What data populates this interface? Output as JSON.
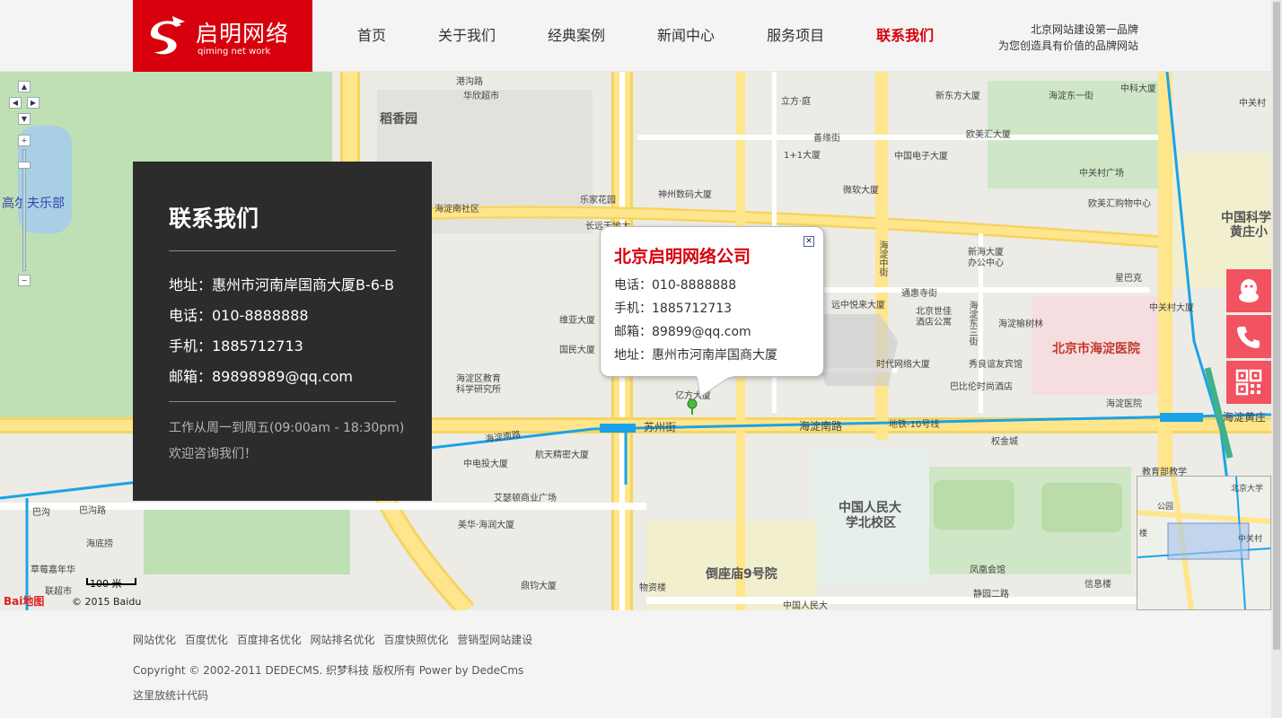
{
  "header": {
    "logo_cn": "启明网络",
    "logo_en": "qiming net work",
    "nav": [
      {
        "label": "首页",
        "active": false
      },
      {
        "label": "关于我们",
        "active": false
      },
      {
        "label": "经典案例",
        "active": false
      },
      {
        "label": "新闻中心",
        "active": false
      },
      {
        "label": "服务项目",
        "active": false
      },
      {
        "label": "联系我们",
        "active": true
      }
    ],
    "slogan_line1": "北京网站建设第一品牌",
    "slogan_line2": "为您创造具有价值的品牌网站"
  },
  "contact": {
    "title": "联系我们",
    "address": "地址：惠州市河南岸国商大厦B-6-B",
    "phone": "电话：010-8888888",
    "mobile": "手机：1885712713",
    "email": "邮箱：89898989@qq.com",
    "hours": "工作从周一到周五(09:00am - 18:30pm)",
    "welcome": "欢迎咨询我们！"
  },
  "popup": {
    "title": "北京启明网络公司",
    "phone": "电话：010-8888888",
    "mobile": "手机：1885712713",
    "email": "邮箱：89899@qq.com",
    "address": "地址：惠州市河南岸国商大厦",
    "close": "✕"
  },
  "map": {
    "scale_label": "100 米",
    "copyright": "© 2015 Baidu",
    "baidu_logo": "Bai地图",
    "labels": {
      "l1": "港沟路",
      "l2": "华欣超市",
      "l3": "稻香园",
      "l4": "立方·庭",
      "l5": "新东方大厦",
      "l6": "海淀东一街",
      "l7": "中科大厦",
      "l8": "中关村",
      "l9": "善缘街",
      "l10": "1+1大厦",
      "l11": "中国电子大厦",
      "l12": "欧美汇大厦",
      "l13": "中关村广场",
      "l14": "神州数码大厦",
      "l15": "微软大厦",
      "l16": "欧美汇购物中心",
      "l17": "乐家花园",
      "l18": "海淀南社区",
      "l19": "长远天地大",
      "l20": "中国科学",
      "l21": "黄庄小",
      "l22": "新海大厦",
      "l23": "办公中心",
      "l24": "星巴克",
      "l25": "通惠寺街",
      "l26": "远中悦来大厦",
      "l27": "北京世佳",
      "l28": "酒店公寓",
      "l29": "海淀榆树林",
      "l30": "中关村大厦",
      "l31": "维亚大厦",
      "l32": "国民大厦",
      "l33": "时代网络大厦",
      "l34": "秀良谊友宾馆",
      "l35": "北京市海淀医院",
      "l36": "海淀区教育",
      "l37": "科学研究所",
      "l38": "亿方大厦",
      "l39": "巴比伦时尚酒店",
      "l40": "海淀医院",
      "l41": "苏州街",
      "l42": "海淀南路",
      "l43": "地铁-10号线",
      "l44": "海淀南路",
      "l45": "海淀黄庄",
      "l46": "权金城",
      "l47": "中电投大厦",
      "l48": "航天精密大厦",
      "l49": "艾瑟顿商业广场",
      "l50": "美华·海润大厦",
      "l51": "中国人民大",
      "l52": "学北校区",
      "l53": "巴沟",
      "l54": "巴沟路",
      "l55": "海底捞",
      "l56": "草莓嘉年华",
      "l57": "联超市",
      "l58": "鼎钧大厦",
      "l59": "物资楼",
      "l60": "倒座庙9号院",
      "l61": "凤凰会馆",
      "l62": "信息楼",
      "l63": "静园二路",
      "l64": "教育部教学",
      "l65": "海淀中街",
      "l66": "海淀东三街",
      "l67": "高尔夫乐部",
      "l68": "中国人民大"
    },
    "overview_labels": {
      "o1": "北京大学",
      "o2": "公园",
      "o3": "中关村",
      "o4": "楼"
    }
  },
  "float": [
    {
      "icon": "qq-icon"
    },
    {
      "icon": "phone-icon"
    },
    {
      "icon": "qrcode-icon"
    }
  ],
  "footer": {
    "links": [
      "网站优化",
      "百度优化",
      "百度排名优化",
      "网站排名优化",
      "百度快照优化",
      "营销型网站建设"
    ],
    "copyright": "Copyright © 2002-2011 DEDECMS. 织梦科技 版权所有 Power by DedeCms",
    "stat": "这里放统计代码"
  },
  "colors": {
    "brand": "#d8000c",
    "panel": "#2c2c2c",
    "float": "#f25360",
    "road_yellow": "#ffe68c",
    "metro": "#1aa3e8"
  }
}
